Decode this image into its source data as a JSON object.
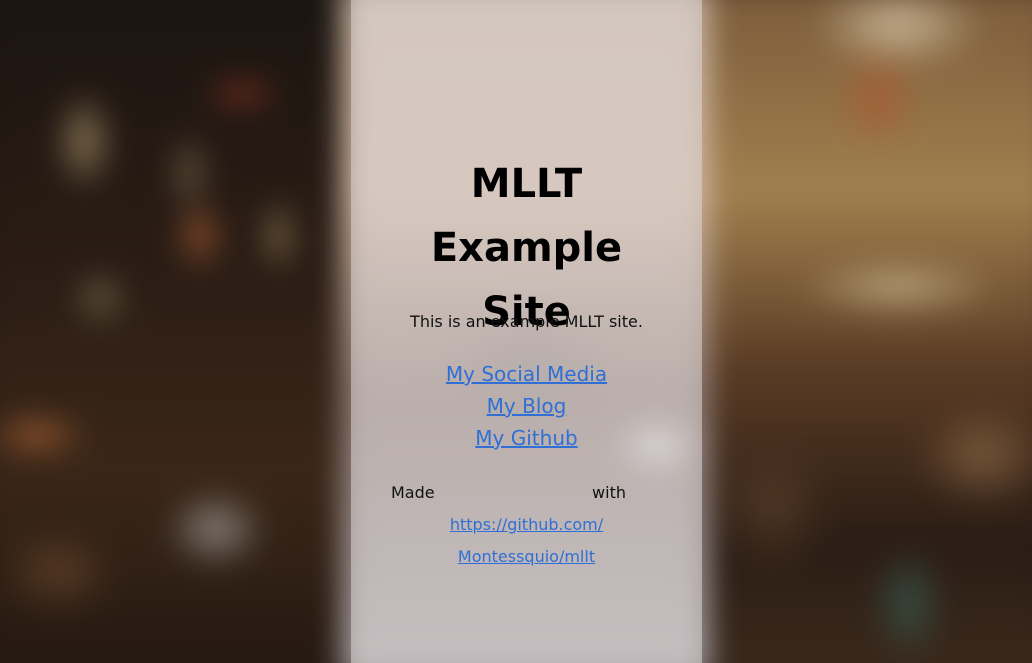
{
  "site": {
    "title": "MLLT Example Site",
    "description": "This is an example MLLT site."
  },
  "links": [
    {
      "label": "My Social Media"
    },
    {
      "label": "My Blog"
    },
    {
      "label": "My Github"
    }
  ],
  "footer": {
    "word1": "Made",
    "word2": "with",
    "link_part1": "https://github.com/",
    "link_part2": "Montessquio/mllt"
  },
  "colors": {
    "link": "#2f6fd6",
    "panel": "#dcd7d7"
  }
}
